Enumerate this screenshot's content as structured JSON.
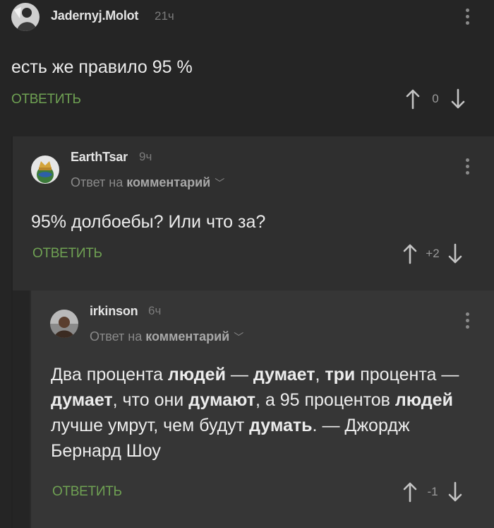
{
  "comments": [
    {
      "author": "Jadernyj.Molot",
      "time": "21ч",
      "text": "есть же правило 95 %",
      "reply_label": "ОТВЕТИТЬ",
      "score": "0"
    },
    {
      "author": "EarthTsar",
      "time": "9ч",
      "reply_prefix": "Ответ на",
      "reply_target": "комментарий",
      "text": "95% долбоебы? Или что за?",
      "reply_label": "ОТВЕТИТЬ",
      "score": "+2"
    },
    {
      "author": "irkinson",
      "time": "6ч",
      "reply_prefix": "Ответ на",
      "reply_target": "комментарий",
      "text_parts": [
        "Два процента ",
        "людей",
        " — ",
        "думает",
        ", ",
        "три",
        " процента — ",
        "думает",
        ", что они ",
        "думают",
        ", а 95 процентов ",
        "людей",
        " лучше умрут, чем будут ",
        "думать",
        ". — Джордж Бернард Шоу"
      ],
      "reply_label": "ОТВЕТИТЬ",
      "score": "-1"
    }
  ],
  "colors": {
    "background": "#252525",
    "nested_1": "#2f2f2f",
    "nested_2": "#363636",
    "accent_green": "#6fa153"
  },
  "icons": [
    "kebab-menu-icon",
    "arrow-up-icon",
    "arrow-down-icon",
    "chevron-down-icon"
  ]
}
